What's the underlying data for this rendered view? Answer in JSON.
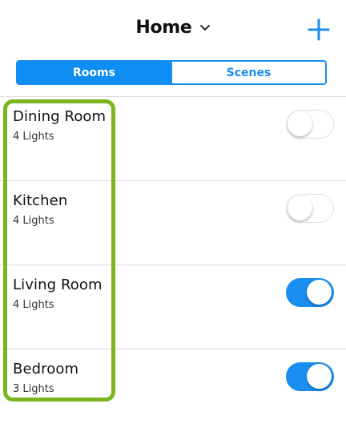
{
  "header": {
    "title": "Home",
    "title_icon": "chevron-down-icon",
    "add_icon": "plus-icon"
  },
  "tabs": [
    {
      "label": "Rooms",
      "selected": true
    },
    {
      "label": "Scenes",
      "selected": false
    }
  ],
  "rooms": [
    {
      "name": "Dining Room",
      "lights": "4 Lights",
      "on": false
    },
    {
      "name": "Kitchen",
      "lights": "4 Lights",
      "on": false
    },
    {
      "name": "Living Room",
      "lights": "4 Lights",
      "on": true
    },
    {
      "name": "Bedroom",
      "lights": "3 Lights",
      "on": true
    }
  ],
  "colors": {
    "accent": "#1a8df0",
    "highlight": "#7ab51d",
    "divider": "#dcdcdc"
  }
}
